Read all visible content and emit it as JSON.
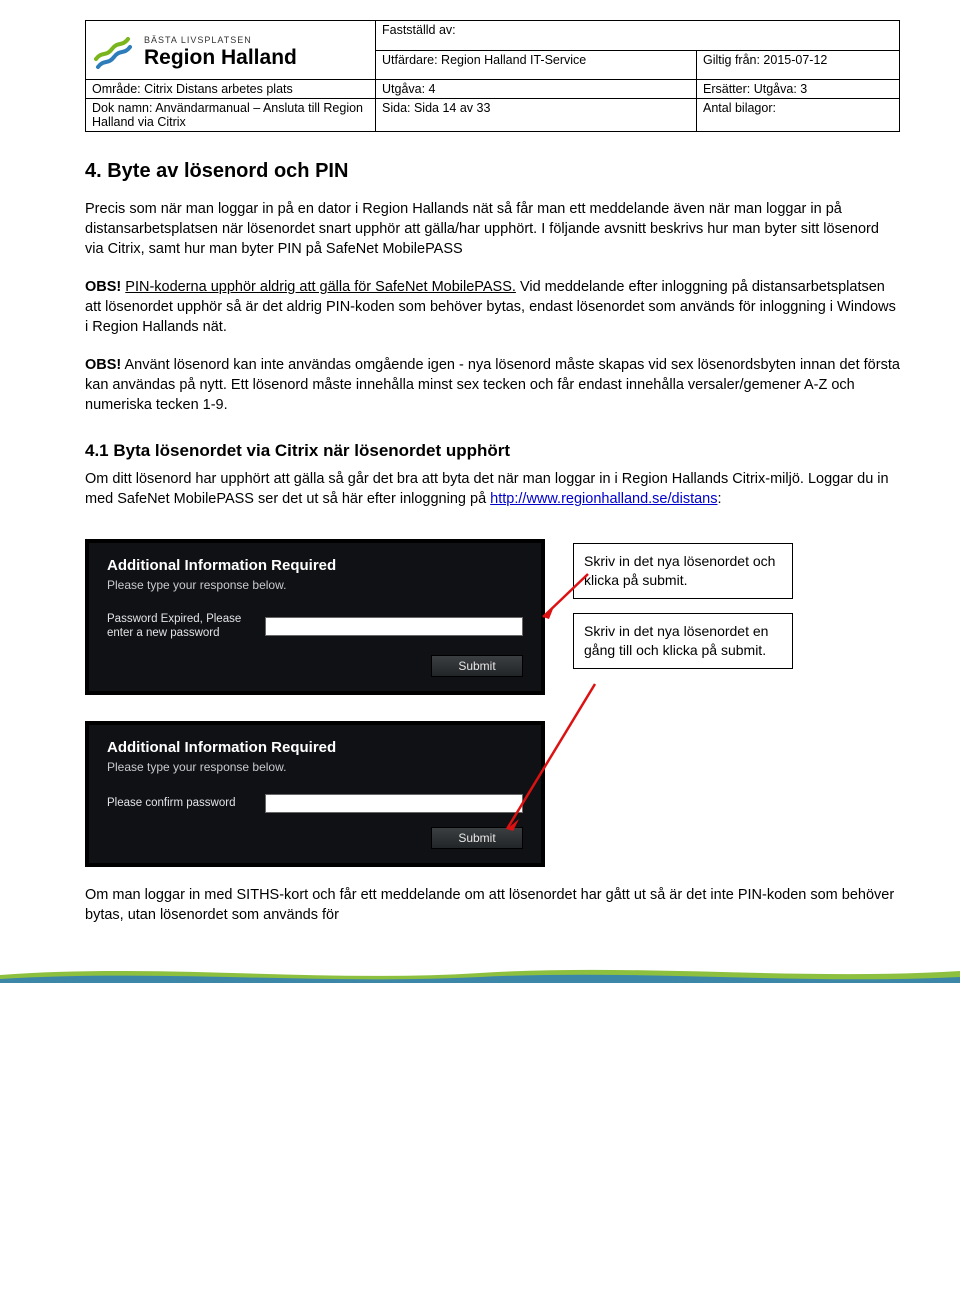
{
  "header": {
    "logo_sub": "BÄSTA LIVSPLATSEN",
    "logo_main": "Region Halland",
    "cells": {
      "faststalld_label": "Fastställd av:",
      "utfardare": "Utfärdare: Region Halland IT-Service",
      "giltig_fran": "Giltig från: 2015-07-12",
      "omrade": "Område: Citrix Distans arbetes plats",
      "utgava": "Utgåva: 4",
      "ersatter": "Ersätter: Utgåva: 3",
      "dok_namn": "Dok namn: Användarmanual – Ansluta till Region Halland via Citrix",
      "sida": "Sida: Sida 14 av 33",
      "bilagor": "Antal bilagor:"
    }
  },
  "section": {
    "title": "4. Byte av lösenord och PIN",
    "p1": "Precis som när man loggar in på en dator i Region Hallands nät så får man ett meddelande även när man loggar in på distansarbetsplatsen när lösenordet snart upphör att gälla/har upphört. I följande avsnitt beskrivs hur man byter sitt lösenord via Citrix, samt hur man byter PIN på SafeNet MobilePASS",
    "p2_strong": "OBS!",
    "p2_ul": "PIN-koderna upphör aldrig att gälla för SafeNet MobilePASS.",
    "p2_rest": " Vid meddelande efter inloggning på distansarbetsplatsen att lösenordet upphör så är det aldrig PIN-koden som behöver bytas, endast lösenordet som används för inloggning i Windows i Region Hallands nät.",
    "p3_strong": "OBS!",
    "p3_rest": " Använt lösenord kan inte användas omgående igen - nya lösenord måste skapas vid sex lösenordsbyten innan det första kan användas på nytt. Ett lösenord måste innehålla minst sex tecken och får endast innehålla versaler/gemener A-Z och numeriska tecken 1-9."
  },
  "section41": {
    "title": "4.1 Byta lösenordet via Citrix när lösenordet upphört",
    "p_pre": "Om ditt lösenord har upphört att gälla så går det bra att byta det när man loggar in i Region Hallands Citrix-miljö. Loggar du in med SafeNet MobilePASS ser det ut så här efter inloggning på ",
    "link_text": "http://www.regionhalland.se/distans",
    "p_post": ":"
  },
  "dialog1": {
    "title": "Additional Information Required",
    "sub": "Please type your response below.",
    "label": "Password Expired, Please enter a new password",
    "button": "Submit"
  },
  "dialog2": {
    "title": "Additional Information Required",
    "sub": "Please type your response below.",
    "label": "Please confirm password",
    "button": "Submit"
  },
  "callouts": {
    "c1": "Skriv in det nya lösenordet och klicka på submit.",
    "c2": "Skriv in det nya lösenordet en gång till och klicka på submit."
  },
  "footer_p": "Om man loggar in med SITHS-kort och får ett meddelande om att lösenordet har gått ut så är det inte PIN-koden som behöver bytas, utan lösenordet som används för"
}
